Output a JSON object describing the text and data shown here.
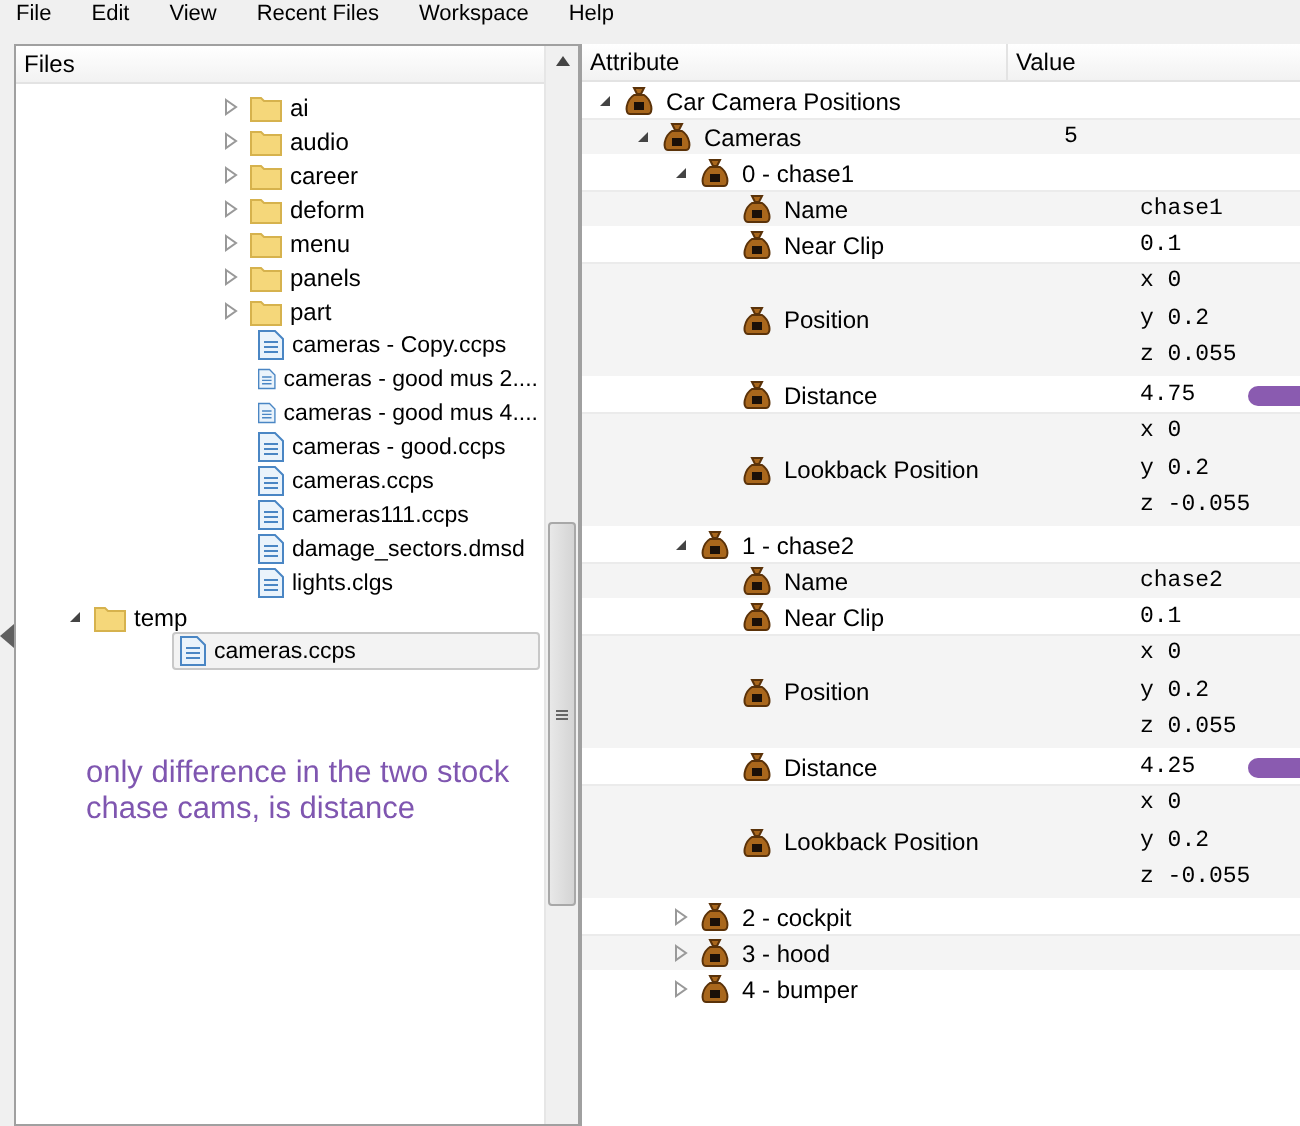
{
  "menu": [
    "File",
    "Edit",
    "View",
    "Recent Files",
    "Workspace",
    "Help"
  ],
  "files": {
    "title": "Files",
    "items": [
      {
        "kind": "scrolled",
        "children": [
          {
            "kind": "scrolled",
            "children": [
              {
                "kind": "folder",
                "label": "ai",
                "expanded": false
              },
              {
                "kind": "folder",
                "label": "audio",
                "expanded": false
              },
              {
                "kind": "folder",
                "label": "career",
                "expanded": false
              },
              {
                "kind": "folder",
                "label": "deform",
                "expanded": false
              },
              {
                "kind": "folder",
                "label": "menu",
                "expanded": false
              },
              {
                "kind": "folder",
                "label": "panels",
                "expanded": false
              },
              {
                "kind": "folder",
                "label": "part",
                "expanded": false
              },
              {
                "kind": "file",
                "label": "cameras - Copy.ccps",
                "selected": false
              },
              {
                "kind": "file",
                "label": "cameras - good mus 2....",
                "selected": false
              },
              {
                "kind": "file",
                "label": "cameras - good mus 4....",
                "selected": false
              },
              {
                "kind": "file",
                "label": "cameras - good.ccps",
                "selected": false
              },
              {
                "kind": "file",
                "label": "cameras.ccps",
                "selected": false
              },
              {
                "kind": "file",
                "label": "cameras111.ccps",
                "selected": false
              },
              {
                "kind": "file",
                "label": "damage_sectors.dmsd",
                "selected": false
              },
              {
                "kind": "file",
                "label": "lights.clgs",
                "selected": false
              }
            ]
          }
        ]
      },
      {
        "kind": "folder",
        "label": "temp",
        "expanded": true,
        "children": [
          {
            "kind": "file",
            "label": "cameras.ccps",
            "selected": true
          }
        ]
      }
    ]
  },
  "note": "only difference in the two stock chase cams, is distance",
  "attributes": {
    "columns": [
      "Attribute",
      "Value"
    ],
    "rows": [
      {
        "label": "Car Camera Positions",
        "expanded": true,
        "children": [
          {
            "label": "Cameras",
            "value": [
              "5"
            ],
            "expanded": true,
            "children": [
              {
                "label": "0 - chase1",
                "expanded": true,
                "children": [
                  {
                    "label": "Name",
                    "value": [
                      "chase1"
                    ]
                  },
                  {
                    "label": "Near Clip",
                    "value": [
                      "0.1"
                    ]
                  },
                  {
                    "label": "Position",
                    "value": [
                      "x 0",
                      "y 0.2",
                      "z 0.055"
                    ]
                  },
                  {
                    "label": "Distance",
                    "value": [
                      "4.75"
                    ],
                    "marked": true
                  },
                  {
                    "label": "Lookback Position",
                    "value": [
                      "x 0",
                      "y 0.2",
                      "z -0.055"
                    ]
                  }
                ]
              },
              {
                "label": "1 - chase2",
                "expanded": true,
                "children": [
                  {
                    "label": "Name",
                    "value": [
                      "chase2"
                    ]
                  },
                  {
                    "label": "Near Clip",
                    "value": [
                      "0.1"
                    ]
                  },
                  {
                    "label": "Position",
                    "value": [
                      "x 0",
                      "y 0.2",
                      "z 0.055"
                    ]
                  },
                  {
                    "label": "Distance",
                    "value": [
                      "4.25"
                    ],
                    "marked": true
                  },
                  {
                    "label": "Lookback Position",
                    "value": [
                      "x 0",
                      "y 0.2",
                      "z -0.055"
                    ]
                  }
                ]
              },
              {
                "label": "2 - cockpit",
                "expanded": false
              },
              {
                "label": "3 - hood",
                "expanded": false
              },
              {
                "label": "4 - bumper",
                "expanded": false
              }
            ]
          }
        ]
      }
    ]
  }
}
